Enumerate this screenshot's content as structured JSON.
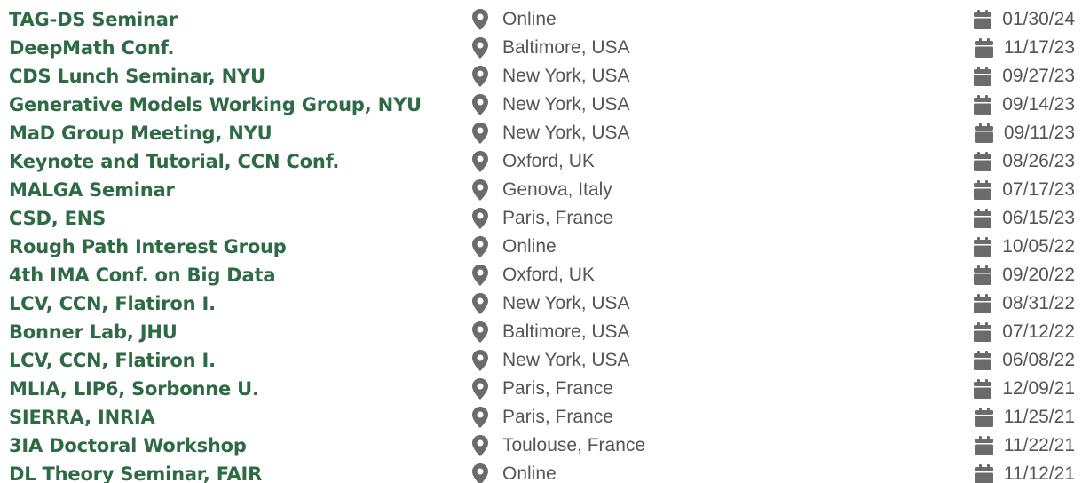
{
  "talks": [
    {
      "title": "TAG-DS Seminar",
      "location": "Online",
      "date": "01/30/24"
    },
    {
      "title": "DeepMath Conf.",
      "location": "Baltimore, USA",
      "date": "11/17/23"
    },
    {
      "title": "CDS Lunch Seminar, NYU",
      "location": "New York, USA",
      "date": "09/27/23"
    },
    {
      "title": "Generative Models Working Group, NYU",
      "location": "New York, USA",
      "date": "09/14/23"
    },
    {
      "title": "MaD Group Meeting, NYU",
      "location": "New York, USA",
      "date": "09/11/23"
    },
    {
      "title": "Keynote and Tutorial, CCN Conf.",
      "location": "Oxford, UK",
      "date": "08/26/23"
    },
    {
      "title": "MALGA Seminar",
      "location": "Genova, Italy",
      "date": "07/17/23"
    },
    {
      "title": "CSD, ENS",
      "location": "Paris, France",
      "date": "06/15/23"
    },
    {
      "title": "Rough Path Interest Group",
      "location": "Online",
      "date": "10/05/22"
    },
    {
      "title": "4th IMA Conf. on Big Data",
      "location": "Oxford, UK",
      "date": "09/20/22"
    },
    {
      "title": "LCV, CCN, Flatiron I.",
      "location": "New York, USA",
      "date": "08/31/22"
    },
    {
      "title": "Bonner Lab, JHU",
      "location": "Baltimore, USA",
      "date": "07/12/22"
    },
    {
      "title": "LCV, CCN, Flatiron I.",
      "location": "New York, USA",
      "date": "06/08/22"
    },
    {
      "title": "MLIA, LIP6, Sorbonne U.",
      "location": "Paris, France",
      "date": "12/09/21"
    },
    {
      "title": "SIERRA, INRIA",
      "location": "Paris, France",
      "date": "11/25/21"
    },
    {
      "title": "3IA Doctoral Workshop",
      "location": "Toulouse, France",
      "date": "11/22/21"
    },
    {
      "title": "DL Theory Seminar, FAIR",
      "location": "Online",
      "date": "11/12/21"
    }
  ],
  "icons": {
    "location": "map-pin-icon",
    "date": "calendar-icon"
  },
  "colors": {
    "title": "#2e6b44",
    "meta_text": "#555555",
    "icon": "#6b6b6b"
  }
}
